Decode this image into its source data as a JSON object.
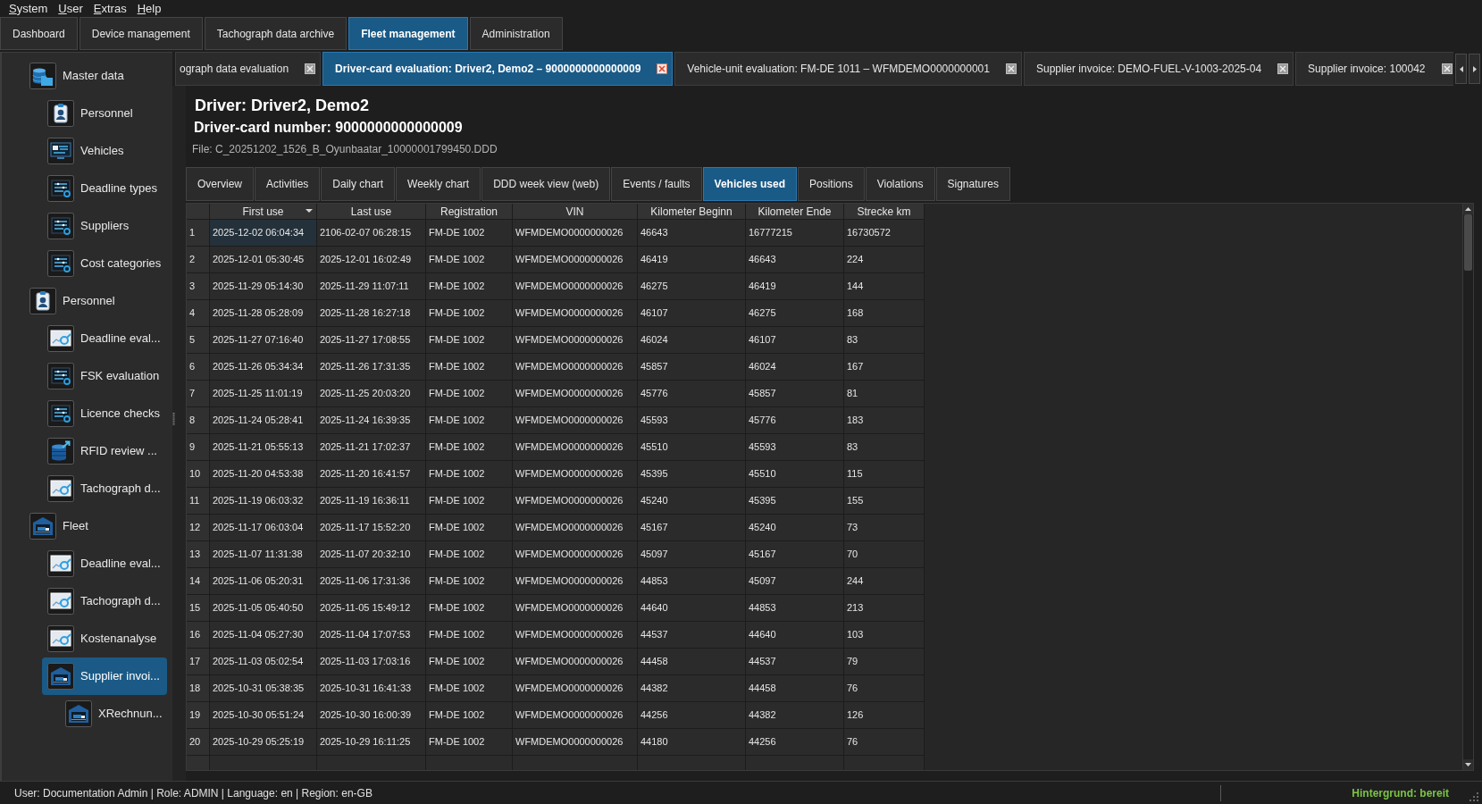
{
  "menu": [
    "System",
    "User",
    "Extras",
    "Help"
  ],
  "main_tabs": [
    {
      "label": "Dashboard",
      "selected": false
    },
    {
      "label": "Device management",
      "selected": false
    },
    {
      "label": "Tachograph data archive",
      "selected": false
    },
    {
      "label": "Fleet management",
      "selected": true
    },
    {
      "label": "Administration",
      "selected": false
    }
  ],
  "sidebar": {
    "items": [
      {
        "label": "Master data",
        "kind": "masterdata",
        "selected": false,
        "children": [
          {
            "label": "Personnel",
            "kind": "personnel",
            "selected": false
          },
          {
            "label": "Vehicles",
            "kind": "vehicles",
            "selected": false
          },
          {
            "label": "Deadline types",
            "kind": "settings",
            "selected": false
          },
          {
            "label": "Suppliers",
            "kind": "settings",
            "selected": false
          },
          {
            "label": "Cost categories",
            "kind": "settings",
            "selected": false
          }
        ]
      },
      {
        "label": "Personnel",
        "kind": "personnel",
        "selected": false,
        "children": [
          {
            "label": "Deadline eval...",
            "kind": "report",
            "selected": false
          },
          {
            "label": "FSK evaluation",
            "kind": "settings",
            "selected": false
          },
          {
            "label": "Licence checks",
            "kind": "settings",
            "selected": false
          },
          {
            "label": "RFID review ...",
            "kind": "transfer",
            "selected": false
          },
          {
            "label": "Tachograph d...",
            "kind": "report",
            "selected": false
          }
        ]
      },
      {
        "label": "Fleet",
        "kind": "fleet",
        "selected": false,
        "children": [
          {
            "label": "Deadline eval...",
            "kind": "report",
            "selected": false
          },
          {
            "label": "Tachograph d...",
            "kind": "report",
            "selected": false
          },
          {
            "label": "Kostenanalyse",
            "kind": "report",
            "selected": false
          },
          {
            "label": "Supplier invoi...",
            "kind": "fleet",
            "selected": true,
            "children": [
              {
                "label": "XRechnun...",
                "kind": "fleet",
                "selected": false
              }
            ]
          }
        ]
      }
    ]
  },
  "document_tabs": [
    {
      "label": "ograph data evaluation",
      "selected": false
    },
    {
      "label": "Driver-card evaluation: Driver2, Demo2 – 9000000000000009",
      "selected": true
    },
    {
      "label": "Vehicle-unit evaluation: FM-DE 1011 – WFMDEMO0000000001",
      "selected": false
    },
    {
      "label": "Supplier invoice: DEMO-FUEL-V-1003-2025-04",
      "selected": false
    },
    {
      "label": "Supplier invoice: 100042",
      "selected": false
    }
  ],
  "driver_header": {
    "driver": "Driver: Driver2, Demo2",
    "card_number": "Driver-card number: 9000000000000009",
    "file": "File: C_20251202_1526_B_Oyunbaatar_10000001799450.DDD"
  },
  "view_tabs": [
    {
      "label": "Overview",
      "selected": false
    },
    {
      "label": "Activities",
      "selected": false
    },
    {
      "label": "Daily chart",
      "selected": false
    },
    {
      "label": "Weekly chart",
      "selected": false
    },
    {
      "label": "DDD week view (web)",
      "selected": false
    },
    {
      "label": "Events / faults",
      "selected": false
    },
    {
      "label": "Vehicles used",
      "selected": true
    },
    {
      "label": "Positions",
      "selected": false
    },
    {
      "label": "Violations",
      "selected": false
    },
    {
      "label": "Signatures",
      "selected": false
    }
  ],
  "table": {
    "columns": [
      {
        "label": "First use",
        "sort_descending": true
      },
      {
        "label": "Last use",
        "sort_descending": false
      },
      {
        "label": "Registration",
        "sort_descending": false
      },
      {
        "label": "VIN",
        "sort_descending": false
      },
      {
        "label": "Kilometer Beginn",
        "sort_descending": false
      },
      {
        "label": "Kilometer Ende",
        "sort_descending": false
      },
      {
        "label": "Strecke km",
        "sort_descending": false
      }
    ],
    "rows": [
      {
        "number": "1",
        "selected": true,
        "cells": [
          "2025-12-02 06:04:34",
          "2106-02-07 06:28:15",
          "FM-DE 1002",
          "WFMDEMO0000000026",
          "46643",
          "16777215",
          "16730572"
        ]
      },
      {
        "number": "2",
        "selected": false,
        "cells": [
          "2025-12-01 05:30:45",
          "2025-12-01 16:02:49",
          "FM-DE 1002",
          "WFMDEMO0000000026",
          "46419",
          "46643",
          "224"
        ]
      },
      {
        "number": "3",
        "selected": false,
        "cells": [
          "2025-11-29 05:14:30",
          "2025-11-29 11:07:11",
          "FM-DE 1002",
          "WFMDEMO0000000026",
          "46275",
          "46419",
          "144"
        ]
      },
      {
        "number": "4",
        "selected": false,
        "cells": [
          "2025-11-28 05:28:09",
          "2025-11-28 16:27:18",
          "FM-DE 1002",
          "WFMDEMO0000000026",
          "46107",
          "46275",
          "168"
        ]
      },
      {
        "number": "5",
        "selected": false,
        "cells": [
          "2025-11-27 07:16:40",
          "2025-11-27 17:08:55",
          "FM-DE 1002",
          "WFMDEMO0000000026",
          "46024",
          "46107",
          "83"
        ]
      },
      {
        "number": "6",
        "selected": false,
        "cells": [
          "2025-11-26 05:34:34",
          "2025-11-26 17:31:35",
          "FM-DE 1002",
          "WFMDEMO0000000026",
          "45857",
          "46024",
          "167"
        ]
      },
      {
        "number": "7",
        "selected": false,
        "cells": [
          "2025-11-25 11:01:19",
          "2025-11-25 20:03:20",
          "FM-DE 1002",
          "WFMDEMO0000000026",
          "45776",
          "45857",
          "81"
        ]
      },
      {
        "number": "8",
        "selected": false,
        "cells": [
          "2025-11-24 05:28:41",
          "2025-11-24 16:39:35",
          "FM-DE 1002",
          "WFMDEMO0000000026",
          "45593",
          "45776",
          "183"
        ]
      },
      {
        "number": "9",
        "selected": false,
        "cells": [
          "2025-11-21 05:55:13",
          "2025-11-21 17:02:37",
          "FM-DE 1002",
          "WFMDEMO0000000026",
          "45510",
          "45593",
          "83"
        ]
      },
      {
        "number": "10",
        "selected": false,
        "cells": [
          "2025-11-20 04:53:38",
          "2025-11-20 16:41:57",
          "FM-DE 1002",
          "WFMDEMO0000000026",
          "45395",
          "45510",
          "115"
        ]
      },
      {
        "number": "11",
        "selected": false,
        "cells": [
          "2025-11-19 06:03:32",
          "2025-11-19 16:36:11",
          "FM-DE 1002",
          "WFMDEMO0000000026",
          "45240",
          "45395",
          "155"
        ]
      },
      {
        "number": "12",
        "selected": false,
        "cells": [
          "2025-11-17 06:03:04",
          "2025-11-17 15:52:20",
          "FM-DE 1002",
          "WFMDEMO0000000026",
          "45167",
          "45240",
          "73"
        ]
      },
      {
        "number": "13",
        "selected": false,
        "cells": [
          "2025-11-07 11:31:38",
          "2025-11-07 20:32:10",
          "FM-DE 1002",
          "WFMDEMO0000000026",
          "45097",
          "45167",
          "70"
        ]
      },
      {
        "number": "14",
        "selected": false,
        "cells": [
          "2025-11-06 05:20:31",
          "2025-11-06 17:31:36",
          "FM-DE 1002",
          "WFMDEMO0000000026",
          "44853",
          "45097",
          "244"
        ]
      },
      {
        "number": "15",
        "selected": false,
        "cells": [
          "2025-11-05 05:40:50",
          "2025-11-05 15:49:12",
          "FM-DE 1002",
          "WFMDEMO0000000026",
          "44640",
          "44853",
          "213"
        ]
      },
      {
        "number": "16",
        "selected": false,
        "cells": [
          "2025-11-04 05:27:30",
          "2025-11-04 17:07:53",
          "FM-DE 1002",
          "WFMDEMO0000000026",
          "44537",
          "44640",
          "103"
        ]
      },
      {
        "number": "17",
        "selected": false,
        "cells": [
          "2025-11-03 05:02:54",
          "2025-11-03 17:03:16",
          "FM-DE 1002",
          "WFMDEMO0000000026",
          "44458",
          "44537",
          "79"
        ]
      },
      {
        "number": "18",
        "selected": false,
        "cells": [
          "2025-10-31 05:38:35",
          "2025-10-31 16:41:33",
          "FM-DE 1002",
          "WFMDEMO0000000026",
          "44382",
          "44458",
          "76"
        ]
      },
      {
        "number": "19",
        "selected": false,
        "cells": [
          "2025-10-30 05:51:24",
          "2025-10-30 16:00:39",
          "FM-DE 1002",
          "WFMDEMO0000000026",
          "44256",
          "44382",
          "126"
        ]
      },
      {
        "number": "20",
        "selected": false,
        "cells": [
          "2025-10-29 05:25:19",
          "2025-10-29 16:11:25",
          "FM-DE 1002",
          "WFMDEMO0000000026",
          "44180",
          "44256",
          "76"
        ]
      }
    ]
  },
  "status_bar": {
    "info": "User: Documentation Admin | Role: ADMIN | Language: en | Region: en-GB",
    "background": "Hintergrund: bereit"
  }
}
